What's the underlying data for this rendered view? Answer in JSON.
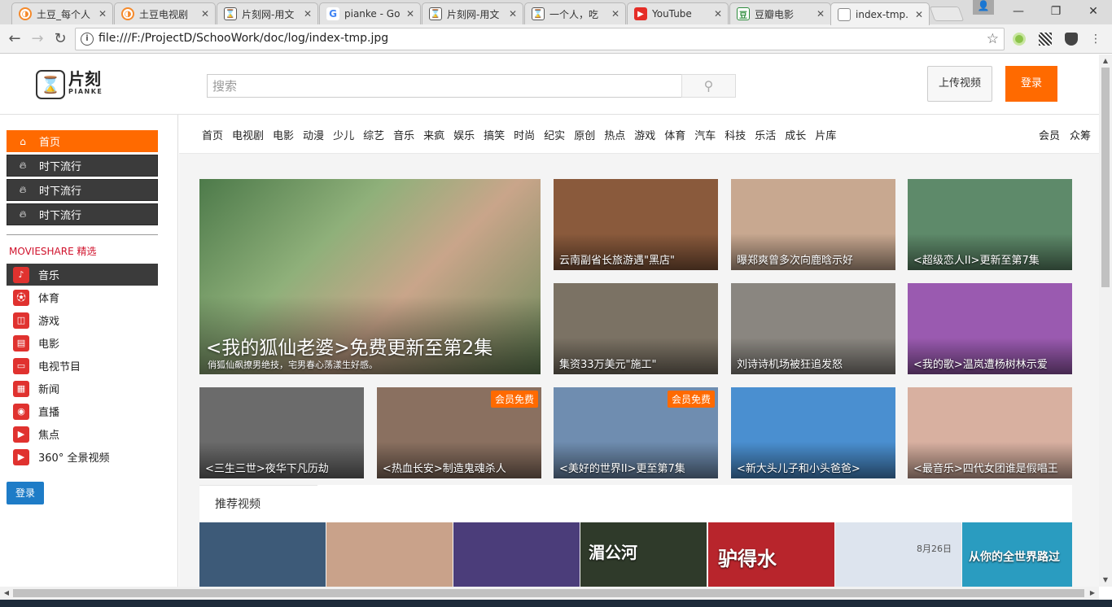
{
  "browser": {
    "tabs": [
      {
        "title": "土豆_每个人",
        "favicon": "tudou"
      },
      {
        "title": "土豆电视剧",
        "favicon": "tudou"
      },
      {
        "title": "片刻网-用文",
        "favicon": "pianke"
      },
      {
        "title": "pianke - Go",
        "favicon": "google"
      },
      {
        "title": "片刻网-用文",
        "favicon": "pianke"
      },
      {
        "title": "一个人，吃",
        "favicon": "pianke"
      },
      {
        "title": "YouTube",
        "favicon": "youtube"
      },
      {
        "title": "豆瓣电影",
        "favicon": "douban"
      },
      {
        "title": "index-tmp.",
        "favicon": "document",
        "active": true
      }
    ],
    "address": "file:///F:/ProjectD/SchooWork/doc/log/index-tmp.jpg",
    "window_buttons": {
      "minimize": "—",
      "maximize": "❐",
      "close": "✕"
    }
  },
  "header": {
    "logo_cn": "片刻",
    "logo_en": "PIANKE",
    "search_placeholder": "搜索",
    "upload_label": "上传视频",
    "login_label": "登录"
  },
  "sidebar": {
    "main_items": [
      {
        "label": "首页",
        "icon": "home-icon",
        "active": true
      },
      {
        "label": "时下流行",
        "icon": "flame-icon"
      },
      {
        "label": "时下流行",
        "icon": "flame-icon"
      },
      {
        "label": "时下流行",
        "icon": "flame-icon"
      }
    ],
    "section_title": "MOVIESHARE 精选",
    "categories": [
      {
        "label": "音乐",
        "icon": "music-icon",
        "active": true
      },
      {
        "label": "体育",
        "icon": "sports-icon"
      },
      {
        "label": "游戏",
        "icon": "gamepad-icon"
      },
      {
        "label": "电影",
        "icon": "film-icon"
      },
      {
        "label": "电视节目",
        "icon": "tv-icon"
      },
      {
        "label": "新闻",
        "icon": "news-icon"
      },
      {
        "label": "直播",
        "icon": "broadcast-icon"
      },
      {
        "label": "焦点",
        "icon": "focus-icon"
      },
      {
        "label": "360° 全景视频",
        "icon": "panorama-icon"
      }
    ],
    "login_label": "登录"
  },
  "channels": [
    "首页",
    "电视剧",
    "电影",
    "动漫",
    "少儿",
    "综艺",
    "音乐",
    "来疯",
    "娱乐",
    "搞笑",
    "时尚",
    "纪实",
    "原创",
    "热点",
    "游戏",
    "体育",
    "汽车",
    "科技",
    "乐活",
    "成长",
    "片库"
  ],
  "channels_right": [
    "会员",
    "众筹"
  ],
  "featured": {
    "title": "<我的狐仙老婆>免费更新至第2集",
    "subtitle": "俏狐仙飙撩男绝技，宅男春心荡漾生好感。"
  },
  "tiles": [
    {
      "caption": "云南副省长旅游遇\"黑店\"",
      "color": "#8a5a3c"
    },
    {
      "caption": "曝郑爽曾多次向鹿晗示好",
      "color": "#c8a890"
    },
    {
      "caption": "<超级恋人II>更新至第7集",
      "color": "#5e8a6a"
    },
    {
      "caption": "集资33万美元\"施工\"",
      "color": "#7b7264"
    },
    {
      "caption": "刘诗诗机场被狂追发怒",
      "color": "#8a8680"
    },
    {
      "caption": "<我的歌>温岚遭杨树林示爱",
      "color": "#9a5ab0"
    },
    {
      "caption": "<三生三世>夜华下凡历劫",
      "color": "#6b6b6b"
    },
    {
      "caption": "<热血长安>制造鬼魂杀人",
      "color": "#8a7060",
      "badge": "会员免费"
    },
    {
      "caption": "<美好的世界II>更至第7集",
      "color": "#6f8db0",
      "badge": "会员免费"
    },
    {
      "caption": "<新大头儿子和小头爸爸>",
      "color": "#4a8fd0"
    },
    {
      "caption": "<最音乐>四代女团谁是假唱王",
      "color": "#d8b0a0"
    }
  ],
  "recommend": {
    "label": "推荐视频",
    "posters": [
      {
        "text": "",
        "color": "#3d5a78"
      },
      {
        "text": "",
        "color": "#c9a28a"
      },
      {
        "text": "",
        "color": "#4b3d7a"
      },
      {
        "text": "湄公河",
        "color": "#2f3a2a"
      },
      {
        "text": "驴得水",
        "color": "#b8252c"
      },
      {
        "text": "8月26日",
        "color": "#dde4ee"
      },
      {
        "text": "从你的全世界路过",
        "color": "#2a9cc0"
      }
    ]
  },
  "colors": {
    "accent": "#ff6a00",
    "sidebar_dark": "#3b3b3b",
    "login_blue": "#1e7cc7",
    "section_red": "#d0112b"
  }
}
